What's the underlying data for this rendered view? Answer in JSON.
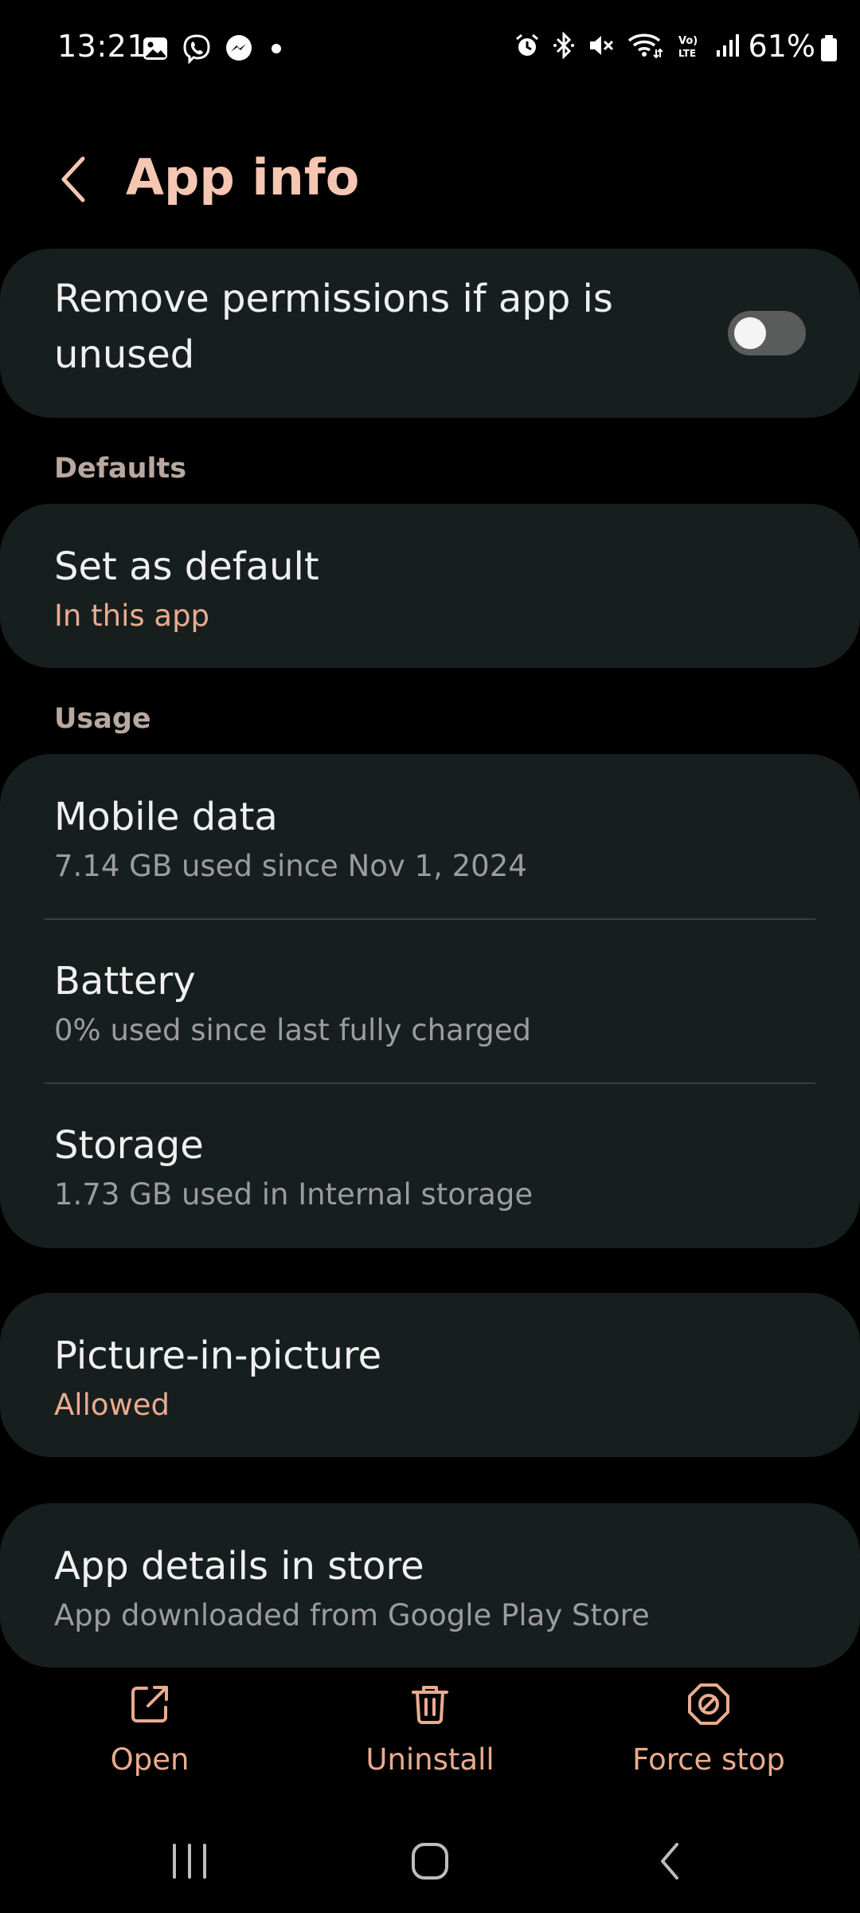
{
  "status_bar": {
    "time": "13:21",
    "battery_percent": "61%",
    "notification_icons": [
      "gallery-icon",
      "viber-icon",
      "messenger-icon",
      "dot-icon"
    ],
    "system_icons": [
      "alarm-icon",
      "bluetooth-icon",
      "mute-icon",
      "wifi-icon",
      "volte-icon",
      "signal-icon",
      "battery-icon"
    ]
  },
  "header": {
    "title": "App info"
  },
  "permissions": {
    "label_line1": "Remove permissions if app is",
    "label_line2": "unused",
    "toggle_on": false
  },
  "defaults": {
    "section_title": "Defaults",
    "set_default": {
      "title": "Set as default",
      "subtitle": "In this app"
    }
  },
  "usage": {
    "section_title": "Usage",
    "items": [
      {
        "title": "Mobile data",
        "subtitle": "7.14 GB used since Nov 1, 2024"
      },
      {
        "title": "Battery",
        "subtitle": "0% used since last fully charged"
      },
      {
        "title": "Storage",
        "subtitle": "1.73 GB used in Internal storage"
      }
    ]
  },
  "pip": {
    "title": "Picture-in-picture",
    "subtitle": "Allowed"
  },
  "store": {
    "title": "App details in store",
    "subtitle": "App downloaded from Google Play Store"
  },
  "actions": [
    {
      "label": "Open",
      "icon": "open-external-icon"
    },
    {
      "label": "Uninstall",
      "icon": "trash-icon"
    },
    {
      "label": "Force stop",
      "icon": "force-stop-icon"
    }
  ],
  "colors": {
    "accent": "#e9ab8e",
    "title_accent": "#f5c6b2",
    "card": "#171e1e",
    "background": "#000000"
  }
}
